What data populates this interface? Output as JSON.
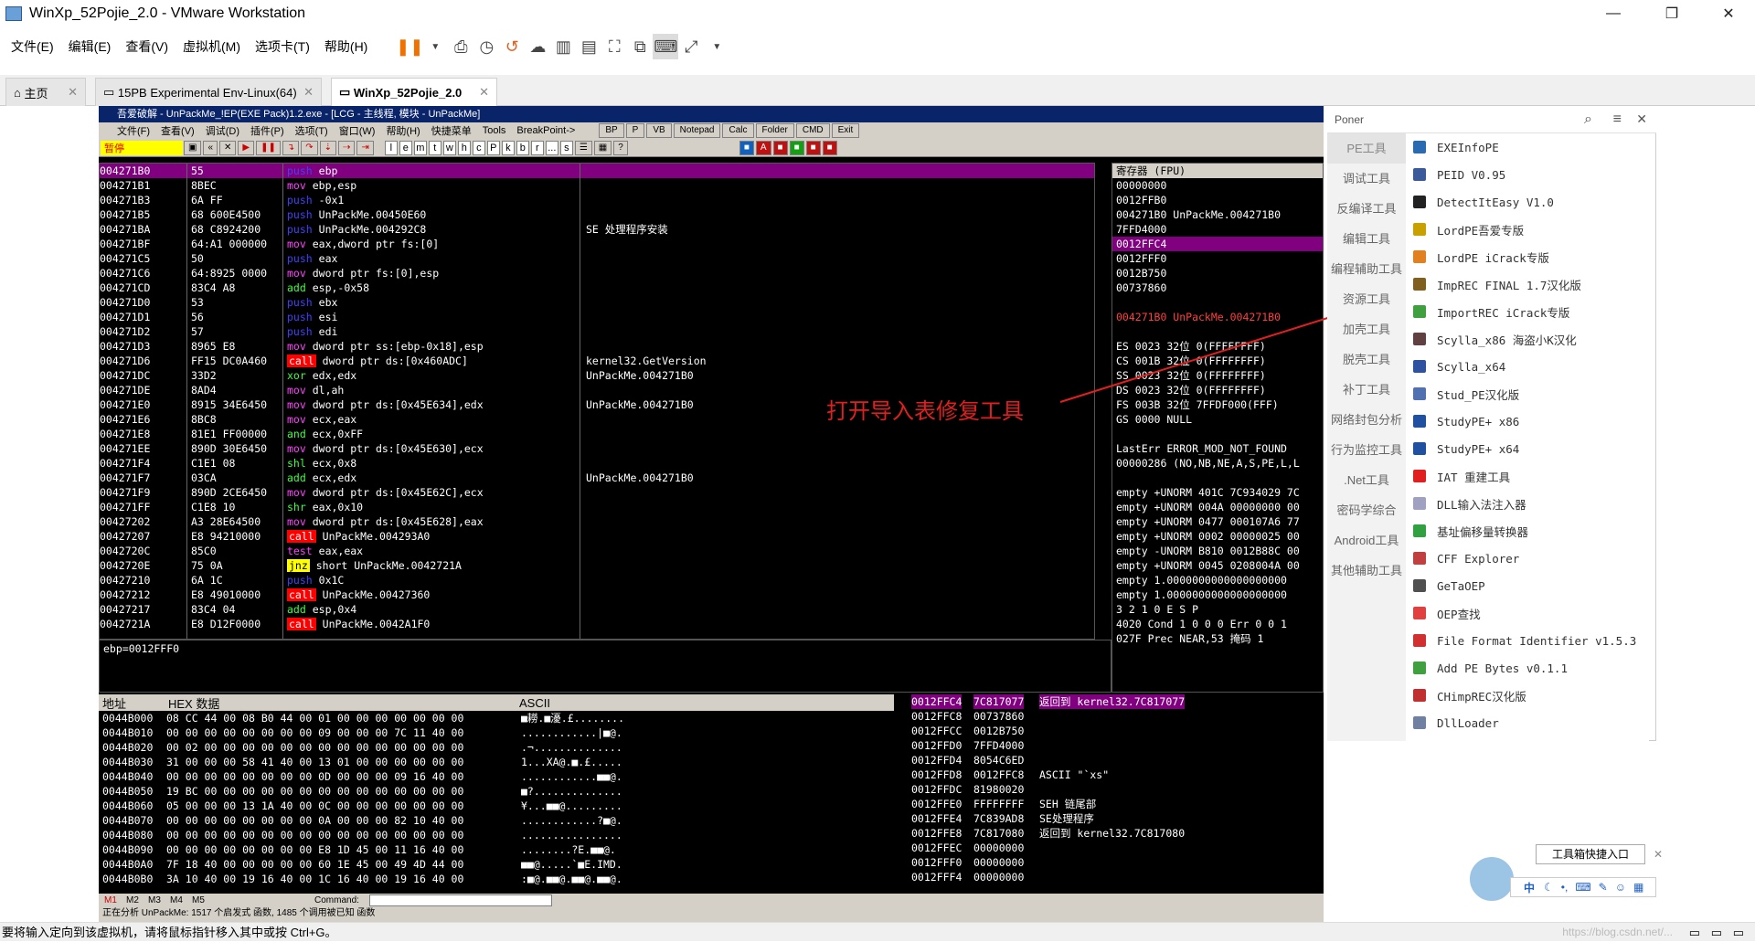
{
  "window": {
    "title": "WinXp_52Pojie_2.0 - VMware Workstation",
    "minimize": "—",
    "maximize": "❐",
    "close": "✕"
  },
  "menu": [
    "文件(E)",
    "编辑(E)",
    "查看(V)",
    "虚拟机(M)",
    "选项卡(T)",
    "帮助(H)"
  ],
  "tabs": [
    {
      "label": "主页"
    },
    {
      "label": "15PB Experimental Env-Linux(64)"
    },
    {
      "label": "WinXp_52Pojie_2.0"
    }
  ],
  "od": {
    "title": "吾爱破解 - UnPackMe_!EP(EXE Pack)1.2.exe - [LCG - 主线程, 模块 - UnPackMe]",
    "menu": [
      "文件(F)",
      "查看(V)",
      "调试(D)",
      "插件(P)",
      "选项(T)",
      "窗口(W)",
      "帮助(H)",
      "快捷菜单",
      "Tools",
      "BreakPoint->"
    ],
    "toolbar_buttons": [
      "BP",
      "P",
      "VB",
      "Notepad",
      "Calc",
      "Folder",
      "CMD",
      "Exit"
    ],
    "letters": [
      "l",
      "e",
      "m",
      "t",
      "w",
      "h",
      "c",
      "P",
      "k",
      "b",
      "r",
      "...",
      "s"
    ],
    "status_label": "暂停",
    "disasm": [
      {
        "a": "004271B0",
        "h": "55",
        "op": "push",
        "arg": "ebp",
        "c": "",
        "hl": true
      },
      {
        "a": "004271B1",
        "h": "8BEC",
        "op": "mov",
        "arg": "ebp,esp",
        "c": ""
      },
      {
        "a": "004271B3",
        "h": "6A FF",
        "op": "push",
        "arg": "-0x1",
        "c": ""
      },
      {
        "a": "004271B5",
        "h": "68 600E4500",
        "op": "push",
        "arg": "UnPackMe.00450E60",
        "c": ""
      },
      {
        "a": "004271BA",
        "h": "68 C8924200",
        "op": "push",
        "arg": "UnPackMe.004292C8",
        "c": "SE 处理程序安装"
      },
      {
        "a": "004271BF",
        "h": "64:A1 000000",
        "op": "mov",
        "arg": "eax,dword ptr fs:[0]",
        "c": ""
      },
      {
        "a": "004271C5",
        "h": "50",
        "op": "push",
        "arg": "eax",
        "c": ""
      },
      {
        "a": "004271C6",
        "h": "64:8925 0000",
        "op": "mov",
        "arg": "dword ptr fs:[0],esp",
        "c": ""
      },
      {
        "a": "004271CD",
        "h": "83C4 A8",
        "op": "add",
        "arg": "esp,-0x58",
        "c": ""
      },
      {
        "a": "004271D0",
        "h": "53",
        "op": "push",
        "arg": "ebx",
        "c": ""
      },
      {
        "a": "004271D1",
        "h": "56",
        "op": "push",
        "arg": "esi",
        "c": ""
      },
      {
        "a": "004271D2",
        "h": "57",
        "op": "push",
        "arg": "edi",
        "c": ""
      },
      {
        "a": "004271D3",
        "h": "8965 E8",
        "op": "mov",
        "arg": "dword ptr ss:[ebp-0x18],esp",
        "c": ""
      },
      {
        "a": "004271D6",
        "h": "FF15 DC0A460",
        "op": "call",
        "arg": "dword ptr ds:[0x460ADC]",
        "c": "kernel32.GetVersion"
      },
      {
        "a": "004271DC",
        "h": "33D2",
        "op": "xor",
        "arg": "edx,edx",
        "c": "UnPackMe.004271B0"
      },
      {
        "a": "004271DE",
        "h": "8AD4",
        "op": "mov",
        "arg": "dl,ah",
        "c": ""
      },
      {
        "a": "004271E0",
        "h": "8915 34E6450",
        "op": "mov",
        "arg": "dword ptr ds:[0x45E634],edx",
        "c": "UnPackMe.004271B0"
      },
      {
        "a": "004271E6",
        "h": "8BC8",
        "op": "mov",
        "arg": "ecx,eax",
        "c": ""
      },
      {
        "a": "004271E8",
        "h": "81E1 FF00000",
        "op": "and",
        "arg": "ecx,0xFF",
        "c": ""
      },
      {
        "a": "004271EE",
        "h": "890D 30E6450",
        "op": "mov",
        "arg": "dword ptr ds:[0x45E630],ecx",
        "c": ""
      },
      {
        "a": "004271F4",
        "h": "C1E1 08",
        "op": "shl",
        "arg": "ecx,0x8",
        "c": ""
      },
      {
        "a": "004271F7",
        "h": "03CA",
        "op": "add",
        "arg": "ecx,edx",
        "c": "UnPackMe.004271B0"
      },
      {
        "a": "004271F9",
        "h": "890D 2CE6450",
        "op": "mov",
        "arg": "dword ptr ds:[0x45E62C],ecx",
        "c": ""
      },
      {
        "a": "004271FF",
        "h": "C1E8 10",
        "op": "shr",
        "arg": "eax,0x10",
        "c": ""
      },
      {
        "a": "00427202",
        "h": "A3 28E64500",
        "op": "mov",
        "arg": "dword ptr ds:[0x45E628],eax",
        "c": ""
      },
      {
        "a": "00427207",
        "h": "E8 94210000",
        "op": "call",
        "arg": "UnPackMe.004293A0",
        "c": ""
      },
      {
        "a": "0042720C",
        "h": "85C0",
        "op": "test",
        "arg": "eax,eax",
        "c": ""
      },
      {
        "a": "0042720E",
        "h": "75 0A",
        "op": "jnz",
        "arg": "short UnPackMe.0042721A",
        "c": ""
      },
      {
        "a": "00427210",
        "h": "6A 1C",
        "op": "push",
        "arg": "0x1C",
        "c": ""
      },
      {
        "a": "00427212",
        "h": "E8 49010000",
        "op": "call",
        "arg": "UnPackMe.00427360",
        "c": ""
      },
      {
        "a": "00427217",
        "h": "83C4 04",
        "op": "add",
        "arg": "esp,0x4",
        "c": ""
      },
      {
        "a": "0042721A",
        "h": "E8 D12F0000",
        "op": "call",
        "arg": "UnPackMe.0042A1F0",
        "c": ""
      }
    ],
    "info": "ebp=0012FFF0",
    "regs_header": "寄存器 (FPU)",
    "regs": [
      "00000000",
      "0012FFB0",
      "004271B0 UnPackMe.004271B0",
      "7FFD4000",
      "0012FFC4",
      "0012FFF0",
      "0012B750",
      "00737860",
      "",
      "004271B0 UnPackMe.004271B0",
      "",
      "ES 0023 32位 0(FFFFFFFF)",
      "CS 001B 32位 0(FFFFFFFF)",
      "SS 0023 32位 0(FFFFFFFF)",
      "DS 0023 32位 0(FFFFFFFF)",
      "FS 003B 32位 7FFDF000(FFF)",
      "GS 0000 NULL",
      "",
      "LastErr ERROR_MOD_NOT_FOUND",
      "00000286 (NO,NB,NE,A,S,PE,L,L",
      "",
      "empty +UNORM 401C 7C934029 7C",
      "empty +UNORM 004A 00000000 00",
      "empty +UNORM 0477 000107A6 77",
      "empty +UNORM 0002 00000025 00",
      "empty -UNORM B810 0012B88C 00",
      "empty +UNORM 0045 0208004A 00",
      "empty 1.0000000000000000000",
      "empty 1.0000000000000000000",
      "         3 2 1 0      E S P",
      "4020  Cond 1 0 0 0  Err 0 0 1",
      "027F  Prec NEAR,53  掩码    1"
    ],
    "dump_header": {
      "addr": "地址",
      "hex": "HEX 数据",
      "ascii": "ASCII"
    },
    "dump": [
      {
        "a": "0044B000",
        "h": "08 CC 44 00 08 B0 44 00 01 00 00 00 00 00 00 00",
        "s": "■耮.■瀀.£........"
      },
      {
        "a": "0044B010",
        "h": "00 00 00 00 00 00 00 00 09 00 00 00 7C 11 40 00",
        "s": "............|■@."
      },
      {
        "a": "0044B020",
        "h": "00 02 00 00 00 00 00 00 00 00 00 00 00 00 00 00",
        "s": ".¬.............."
      },
      {
        "a": "0044B030",
        "h": "31 00 00 00 58 41 40 00 13 01 00 00 00 00 00 00",
        "s": "1...XA@.■.£....."
      },
      {
        "a": "0044B040",
        "h": "00 00 00 00 00 00 00 00 0D 00 00 00 09 16 40 00",
        "s": "............■■@."
      },
      {
        "a": "0044B050",
        "h": "19 BC 00 00 00 00 00 00 00 00 00 00 00 00 00 00",
        "s": "■?.............."
      },
      {
        "a": "0044B060",
        "h": "05 00 00 00 13 1A 40 00 0C 00 00 00 00 00 00 00",
        "s": "¥...■■@........."
      },
      {
        "a": "0044B070",
        "h": "00 00 00 00 00 00 00 00 0A 00 00 00 82 10 40 00",
        "s": "............?■@."
      },
      {
        "a": "0044B080",
        "h": "00 00 00 00 00 00 00 00 00 00 00 00 00 00 00 00",
        "s": "................"
      },
      {
        "a": "0044B090",
        "h": "00 00 00 00 00 00 00 00 E8 1D 45 00 11 16 40 00",
        "s": "........?E.■■@."
      },
      {
        "a": "0044B0A0",
        "h": "7F 18 40 00 00 00 00 00 60 1E 45 00 49 4D 44 00",
        "s": "■■@.....`■E.IMD."
      },
      {
        "a": "0044B0B0",
        "h": "3A 10 40 00 19 16 40 00 1C 16 40 00 19 16 40 00",
        "s": ":■@.■■@.■■@.■■@."
      }
    ],
    "stack": [
      {
        "a": "0012FFC4",
        "v": "7C817077",
        "c": "返回到 kernel32.7C817077",
        "hl": true
      },
      {
        "a": "0012FFC8",
        "v": "00737860",
        "c": ""
      },
      {
        "a": "0012FFCC",
        "v": "0012B750",
        "c": ""
      },
      {
        "a": "0012FFD0",
        "v": "7FFD4000",
        "c": ""
      },
      {
        "a": "0012FFD4",
        "v": "8054C6ED",
        "c": ""
      },
      {
        "a": "0012FFD8",
        "v": "0012FFC8",
        "c": "ASCII \"`xs\""
      },
      {
        "a": "0012FFDC",
        "v": "81980020",
        "c": ""
      },
      {
        "a": "0012FFE0",
        "v": "FFFFFFFF",
        "c": "SEH 链尾部"
      },
      {
        "a": "0012FFE4",
        "v": "7C839AD8",
        "c": "SE处理程序"
      },
      {
        "a": "0012FFE8",
        "v": "7C817080",
        "c": "返回到 kernel32.7C817080"
      },
      {
        "a": "0012FFEC",
        "v": "00000000",
        "c": ""
      },
      {
        "a": "0012FFF0",
        "v": "00000000",
        "c": ""
      },
      {
        "a": "0012FFF4",
        "v": "00000000",
        "c": ""
      }
    ],
    "cmd_tabs": [
      "M1",
      "M2",
      "M3",
      "M4",
      "M5"
    ],
    "command_label": "Command:",
    "status_line": "正在分析 UnPackMe: 1517 个启发式 函数, 1485 个调用被已知 函数"
  },
  "annotation": "打开导入表修复工具",
  "poner": {
    "title": "Poner",
    "categories": [
      "PE工具",
      "调试工具",
      "反编译工具",
      "编辑工具",
      "编程辅助工具",
      "资源工具",
      "加壳工具",
      "脱壳工具",
      "补丁工具",
      "网络封包分析",
      "行为监控工具",
      ".Net工具",
      "密码学综合",
      "Android工具",
      "其他辅助工具"
    ],
    "items": [
      {
        "label": "EXEInfoPE",
        "color": "#2a6ab0"
      },
      {
        "label": "PEID V0.95",
        "color": "#3a5a9a"
      },
      {
        "label": "DetectItEasy V1.0",
        "color": "#222222"
      },
      {
        "label": "LordPE吾爱专版",
        "color": "#c8a000"
      },
      {
        "label": "LordPE iCrack专版",
        "color": "#e08020"
      },
      {
        "label": "ImpREC FINAL 1.7汉化版",
        "color": "#806020"
      },
      {
        "label": "ImportREC iCrack专版",
        "color": "#40a040"
      },
      {
        "label": "Scylla_x86 海盗小K汉化",
        "color": "#604040"
      },
      {
        "label": "Scylla_x64",
        "color": "#3050a0"
      },
      {
        "label": "Stud_PE汉化版",
        "color": "#5070b0"
      },
      {
        "label": "StudyPE+ x86",
        "color": "#2050a0"
      },
      {
        "label": "StudyPE+ x64",
        "color": "#2050a0"
      },
      {
        "label": "IAT 重建工具",
        "color": "#e02020"
      },
      {
        "label": "DLL输入法注入器",
        "color": "#a0a0c0"
      },
      {
        "label": "基址偏移量转换器",
        "color": "#30a040"
      },
      {
        "label": "CFF Explorer",
        "color": "#c04040"
      },
      {
        "label": "GeTaOEP",
        "color": "#505050"
      },
      {
        "label": "OEP查找",
        "color": "#e04040"
      },
      {
        "label": "File Format Identifier v1.5.3",
        "color": "#d03030"
      },
      {
        "label": "Add PE Bytes v0.1.1",
        "color": "#40a040"
      },
      {
        "label": "CHimpREC汉化版",
        "color": "#c03030"
      },
      {
        "label": "DllLoader",
        "color": "#7080a0"
      }
    ]
  },
  "toolbox_tip": "工具箱快捷入口",
  "ime": "中",
  "status": "要将输入定向到该虚拟机，请将鼠标指针移入其中或按 Ctrl+G。",
  "watermark": "https://blog.csdn.net/..."
}
